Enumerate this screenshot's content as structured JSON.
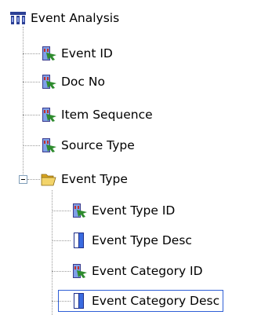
{
  "tree": {
    "root": {
      "label": "Event Analysis",
      "icon": "cube-icon"
    },
    "attributes": [
      {
        "label": "Event ID",
        "icon": "attribute-key-icon"
      },
      {
        "label": "Doc No",
        "icon": "attribute-key-icon"
      },
      {
        "label": "Item Sequence",
        "icon": "attribute-key-icon"
      },
      {
        "label": "Source Type",
        "icon": "attribute-key-icon"
      }
    ],
    "folder": {
      "label": "Event Type",
      "icon": "open-folder-icon",
      "expanded": true,
      "children": [
        {
          "label": "Event Type ID",
          "icon": "attribute-key-icon"
        },
        {
          "label": "Event Type Desc",
          "icon": "attribute-desc-icon"
        },
        {
          "label": "Event Category ID",
          "icon": "attribute-key-icon"
        },
        {
          "label": "Event Category Desc",
          "icon": "attribute-desc-icon",
          "selected": true
        }
      ]
    }
  },
  "colors": {
    "selection_border": "#2f5fd6",
    "connector": "#9a9a9a",
    "folder": "#f3d46a"
  }
}
